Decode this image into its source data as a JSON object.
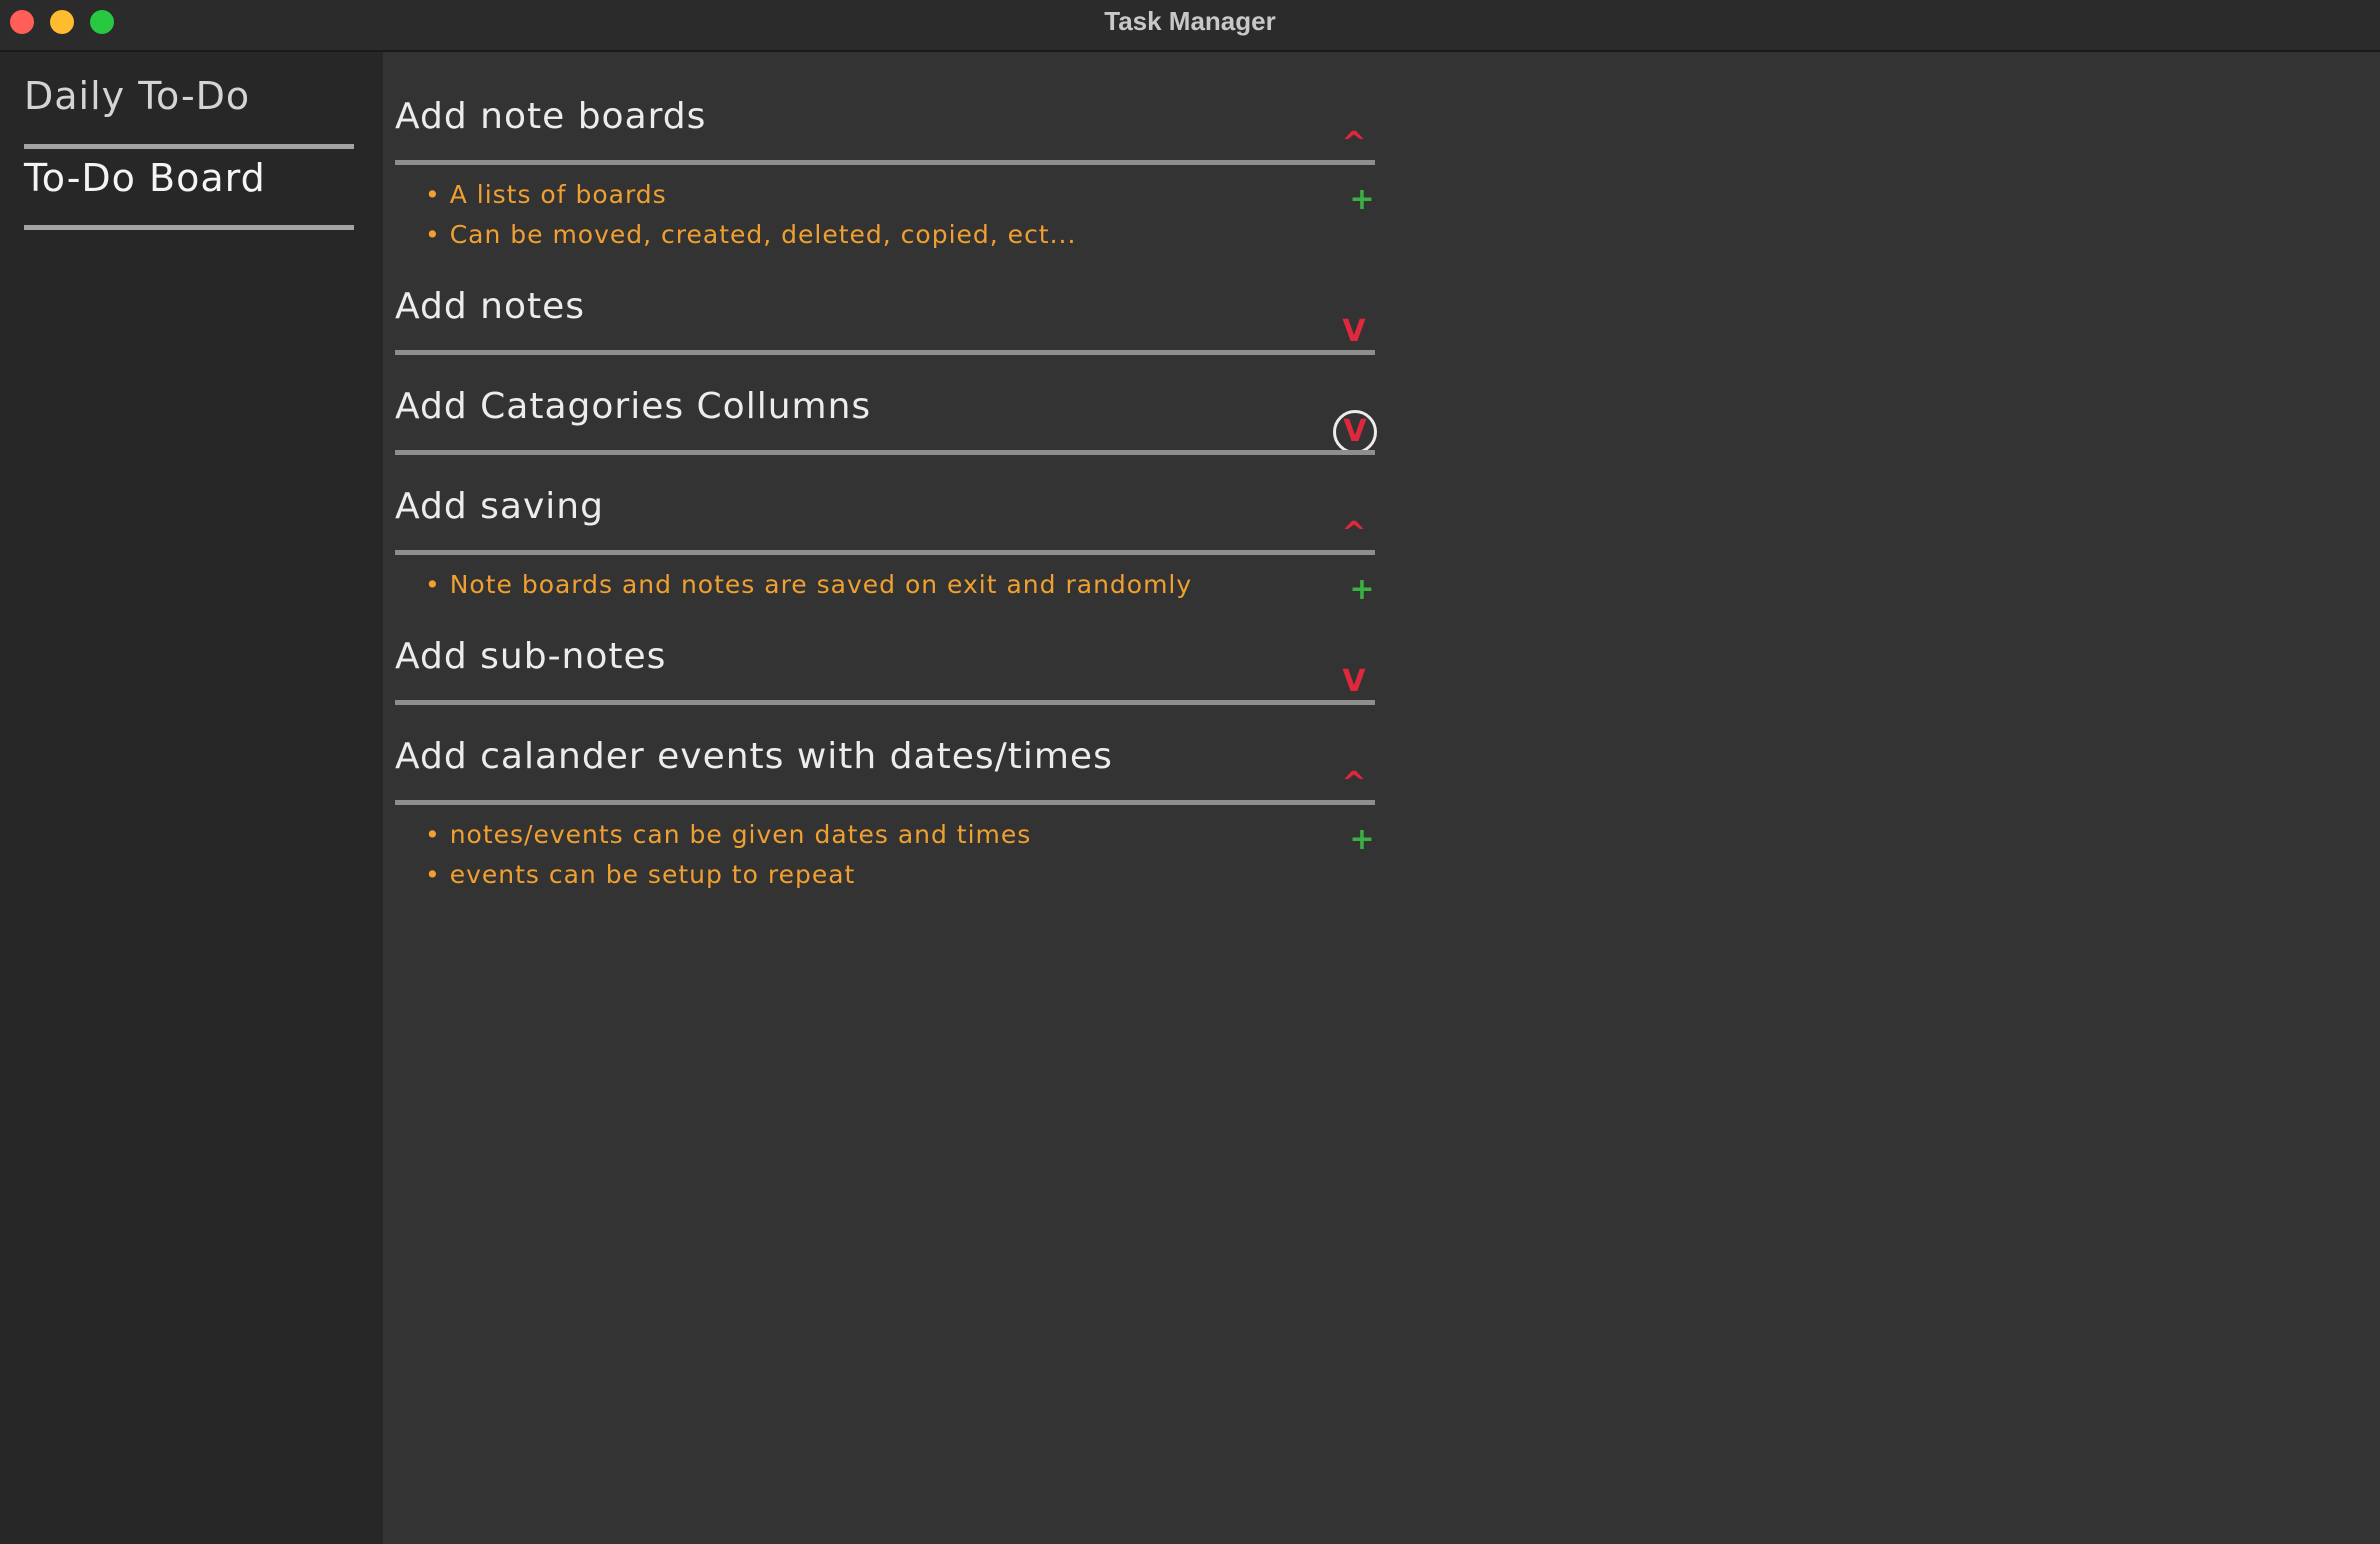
{
  "window": {
    "title": "Task Manager"
  },
  "sidebar": {
    "items": [
      {
        "label": "Daily To-Do"
      },
      {
        "label": "To-Do Board"
      }
    ]
  },
  "board": {
    "sections": [
      {
        "title": "Add note boards",
        "state": "expanded",
        "toggle_glyph": "^",
        "notes": [
          "• A lists of boards",
          "• Can be moved, created, deleted, copied, ect..."
        ],
        "add_glyph": "+"
      },
      {
        "title": "Add notes",
        "state": "collapsed",
        "toggle_glyph": "V",
        "notes": []
      },
      {
        "title": "Add Catagories Collumns",
        "state": "collapsed",
        "toggle_glyph": "V",
        "notes": []
      },
      {
        "title": "Add saving",
        "state": "expanded",
        "toggle_glyph": "^",
        "notes": [
          "• Note boards and notes are saved on exit and randomly"
        ],
        "add_glyph": "+"
      },
      {
        "title": "Add sub-notes",
        "state": "collapsed",
        "toggle_glyph": "V",
        "notes": []
      },
      {
        "title": "Add calander events with dates/times",
        "state": "expanded",
        "toggle_glyph": "^",
        "notes": [
          "• notes/events can be given dates and times",
          "• events can be setup to repeat"
        ],
        "add_glyph": "+"
      }
    ]
  },
  "colors": {
    "title_text": "#ececec",
    "note_text": "#f0a030",
    "toggle": "#e0283c",
    "add": "#3cb043"
  }
}
